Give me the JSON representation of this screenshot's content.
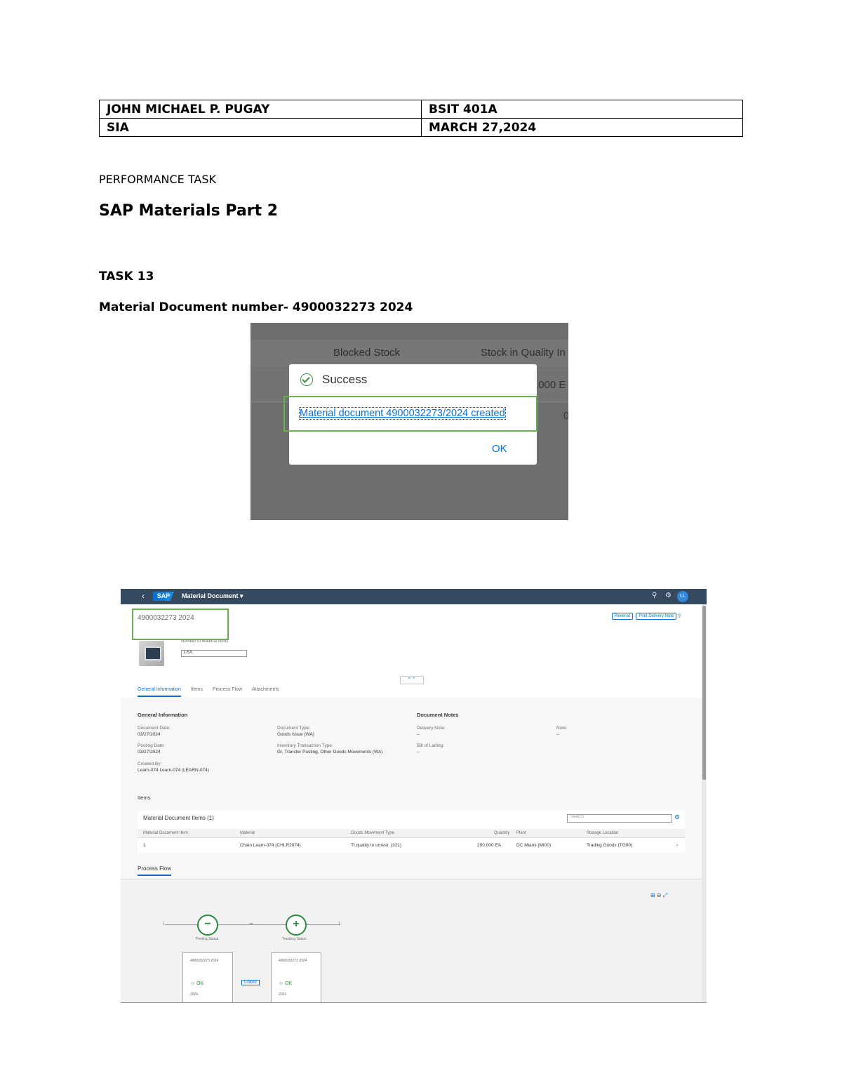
{
  "header_table": {
    "row1": {
      "name": "JOHN MICHAEL P. PUGAY",
      "section": "BSIT 401A"
    },
    "row2": {
      "subject": "SIA",
      "date": "MARCH 27,2024"
    }
  },
  "performance_task": "PERFORMANCE TASK",
  "doc_title": "SAP Materials Part 2",
  "task_label": "TASK 13",
  "material_doc_line": "Material Document number- 4900032273 2024",
  "screenshot1": {
    "col_blocked": "Blocked Stock",
    "col_quality": "Stock in Quality In",
    "bg_value": ".000 E",
    "bg_value2": "0",
    "dialog": {
      "title": "Success",
      "message": "Material document 4900032273/2024 created",
      "ok": "OK"
    },
    "colors": {
      "highlight": "#6ab04c",
      "link": "#0a6ed1",
      "success": "#3e8e41"
    }
  },
  "screenshot2": {
    "shell": {
      "back": "‹",
      "logo": "SAP",
      "app_title": "Material Document ▾",
      "avatar": "LL"
    },
    "object_title": "4900032273 2024",
    "actions": [
      "Reverse",
      "Print Delivery Note"
    ],
    "share": "⇪",
    "key_field_label": "Number of Material Items",
    "key_field_value": "1 EA",
    "collapse": "^ ⌃",
    "tabs": [
      "General Information",
      "Items",
      "Process Flow",
      "Attachments"
    ],
    "general_info": {
      "title": "General Information",
      "document_date_label": "Document Date:",
      "document_date": "03/27/2024",
      "posting_date_label": "Posting Date:",
      "posting_date": "03/27/2024",
      "created_by_label": "Created By:",
      "created_by": "Learn-074 Learn-074 (LEARN-074)",
      "document_type_label": "Document Type:",
      "document_type": "Goods Issue (WA)",
      "transaction_type_label": "Inventory Transaction Type:",
      "transaction_type": "GI, Transfer Posting, Other Goods Movements (WA)"
    },
    "document_notes": {
      "title": "Document Notes",
      "delivery_note_label": "Delivery Note:",
      "delivery_note": "–",
      "bill_of_lading_label": "Bill of Lading:",
      "bill_of_lading": "–",
      "notes_label": "Note:",
      "notes": "–"
    },
    "items_section": "Items",
    "items_table": {
      "title": "Material Document Items (1)",
      "search_placeholder": "Search",
      "settings_icon": "⚙",
      "columns": [
        "Material Document Item",
        "Material",
        "Goods Movement Type",
        "Quantity",
        "Plant",
        "Storage Location"
      ],
      "row": [
        "1",
        "Chain Learn-074 (CHLR2074)",
        "Tr.quality to unrest. (321)",
        "200.000 EA",
        "DC Miami (MI00)",
        "Trading Goods (TG00)",
        "›"
      ]
    },
    "process_flow": {
      "tab": "Process Flow",
      "controls": "⊞ ⊖ ⤢",
      "node1_label": "Posting Status",
      "node2_label": "Tracking Status",
      "node_start": "|",
      "node_mid": "⇒",
      "node_end": "|",
      "card1": {
        "title": "4900032273 2024",
        "status": "☺ OK",
        "date": "2024"
      },
      "card2": {
        "title": "4900032273 2024",
        "status": "☺ OK",
        "date": "2024"
      },
      "link_label": "Linked"
    },
    "colors": {
      "shell": "#354a5f",
      "accent": "#0a6ed1",
      "flow_green": "#2b8a3e",
      "highlight": "#6ab04c"
    }
  }
}
